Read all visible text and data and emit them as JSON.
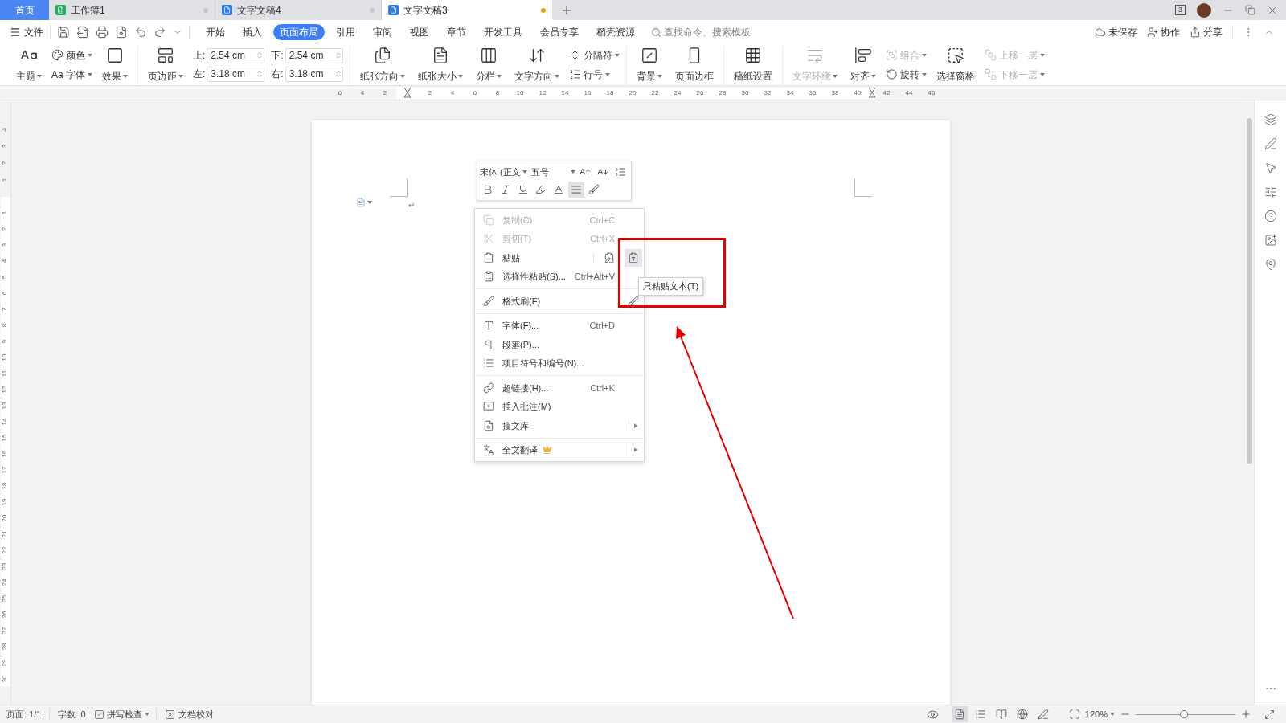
{
  "window": {
    "window_count": "3"
  },
  "tabs": [
    {
      "label": "首页",
      "kind": "home",
      "selected": false
    },
    {
      "label": "工作簿1",
      "kind": "sheet",
      "selected": false,
      "unsaved": false
    },
    {
      "label": "文字文稿4",
      "kind": "writer",
      "selected": false,
      "unsaved": false
    },
    {
      "label": "文字文稿3",
      "kind": "writer",
      "selected": true,
      "unsaved": true
    }
  ],
  "menu": {
    "file": "文件",
    "tabs": [
      {
        "label": "开始",
        "selected": false
      },
      {
        "label": "插入",
        "selected": false
      },
      {
        "label": "页面布局",
        "selected": true
      },
      {
        "label": "引用",
        "selected": false
      },
      {
        "label": "审阅",
        "selected": false
      },
      {
        "label": "视图",
        "selected": false
      },
      {
        "label": "章节",
        "selected": false
      },
      {
        "label": "开发工具",
        "selected": false
      },
      {
        "label": "会员专享",
        "selected": false
      },
      {
        "label": "稻壳资源",
        "selected": false
      }
    ],
    "search": {
      "placeholder": "查找命令、搜索模板"
    },
    "actions": [
      "未保存",
      "协作",
      "分享"
    ]
  },
  "ribbon": {
    "groups": [
      {
        "items": [
          {
            "kind": "large",
            "label": "主题",
            "dropdown": true,
            "disabled": false
          },
          {
            "kind": "stack",
            "entries": [
              {
                "label": "颜色",
                "dropdown": true,
                "disabled": false
              },
              {
                "glyph": "Aa",
                "label": "字体",
                "dropdown": true,
                "disabled": false
              }
            ]
          },
          {
            "kind": "large",
            "label": "效果",
            "dropdown": true,
            "disabled": false
          }
        ]
      },
      {
        "items": [
          {
            "kind": "large",
            "label": "页边距",
            "dropdown": true,
            "disabled": false
          },
          {
            "kind": "margins",
            "fields": [
              {
                "label": "上:",
                "value": "2.54 cm"
              },
              {
                "label": "下:",
                "value": "2.54 cm"
              },
              {
                "label": "左:",
                "value": "3.18 cm"
              },
              {
                "label": "右:",
                "value": "3.18 cm"
              }
            ]
          }
        ]
      },
      {
        "items": [
          {
            "kind": "large",
            "label": "纸张方向",
            "dropdown": true,
            "disabled": false
          },
          {
            "kind": "large",
            "label": "纸张大小",
            "dropdown": true,
            "disabled": false
          },
          {
            "kind": "large",
            "label": "分栏",
            "dropdown": true,
            "disabled": false
          },
          {
            "kind": "large",
            "label": "文字方向",
            "dropdown": true,
            "disabled": false
          },
          {
            "kind": "stack",
            "entries": [
              {
                "label": "分隔符",
                "dropdown": true,
                "disabled": false
              },
              {
                "label": "行号",
                "dropdown": true,
                "disabled": false
              }
            ]
          }
        ]
      },
      {
        "items": [
          {
            "kind": "large",
            "label": "背景",
            "dropdown": true,
            "disabled": false
          },
          {
            "kind": "large",
            "label": "页面边框",
            "dropdown": false,
            "disabled": false
          }
        ]
      },
      {
        "items": [
          {
            "kind": "large",
            "label": "稿纸设置",
            "dropdown": false,
            "disabled": false
          }
        ]
      },
      {
        "items": [
          {
            "kind": "large",
            "label": "文字环绕",
            "dropdown": true,
            "disabled": true
          },
          {
            "kind": "large",
            "label": "对齐",
            "dropdown": true,
            "disabled": false
          },
          {
            "kind": "stack",
            "entries": [
              {
                "label": "组合",
                "dropdown": true,
                "disabled": true
              },
              {
                "label": "旋转",
                "dropdown": true,
                "disabled": false
              }
            ]
          },
          {
            "kind": "large",
            "label": "选择窗格",
            "dropdown": false,
            "disabled": false
          },
          {
            "kind": "stack",
            "entries": [
              {
                "label": "上移一层",
                "dropdown": true,
                "disabled": true
              },
              {
                "label": "下移一层",
                "dropdown": true,
                "disabled": true
              }
            ]
          }
        ]
      }
    ]
  },
  "ruler": {
    "before": [
      "6",
      "4",
      "2"
    ],
    "inside": [
      "2",
      "4",
      "6",
      "8",
      "10",
      "12",
      "14",
      "16",
      "18",
      "20",
      "22",
      "24",
      "26",
      "28",
      "30",
      "32",
      "34",
      "36",
      "38",
      "40"
    ],
    "after": [
      "42",
      "44",
      "46"
    ],
    "above": [
      "4",
      "3",
      "2",
      "1"
    ],
    "below": [
      "1",
      "2",
      "3",
      "4",
      "5",
      "6",
      "7",
      "8",
      "9",
      "10",
      "11",
      "12",
      "13",
      "14",
      "15",
      "16",
      "17",
      "18",
      "19",
      "20",
      "21",
      "22",
      "23",
      "24",
      "25",
      "26",
      "27",
      "28",
      "29",
      "30"
    ]
  },
  "page": {
    "paragraph_mark": "↵"
  },
  "mini_toolbar": {
    "font": "宋体 (正文",
    "size": "五号",
    "buttons": [
      {
        "kind": "grow",
        "selected": false
      },
      {
        "kind": "shrink",
        "selected": false
      },
      {
        "kind": "spacing",
        "selected": false
      },
      {
        "kind": "bold",
        "selected": false
      },
      {
        "kind": "italic",
        "selected": false
      },
      {
        "kind": "underline",
        "selected": false
      },
      {
        "kind": "highlight",
        "selected": false
      },
      {
        "kind": "color",
        "selected": false
      },
      {
        "kind": "align",
        "selected": true
      },
      {
        "kind": "painter",
        "selected": false
      }
    ]
  },
  "context_menu": {
    "sections": [
      [
        {
          "kind": "item",
          "label": "复制(C)",
          "shortcut": "Ctrl+C",
          "disabled": true,
          "submenu": false
        },
        {
          "kind": "item",
          "label": "剪切(T)",
          "shortcut": "Ctrl+X",
          "disabled": true,
          "submenu": false
        },
        {
          "kind": "paste",
          "label": "粘贴",
          "disabled": false,
          "submenu": false,
          "options": [
            {
              "selected": false
            },
            {
              "selected": true
            }
          ]
        },
        {
          "kind": "item",
          "label": "选择性粘贴(S)...",
          "shortcut": "Ctrl+Alt+V",
          "disabled": false,
          "submenu": false
        }
      ],
      [
        {
          "kind": "format",
          "label": "格式刷(F)",
          "disabled": false,
          "submenu": false
        }
      ],
      [
        {
          "kind": "item",
          "label": "字体(F)...",
          "shortcut": "Ctrl+D",
          "disabled": false,
          "submenu": false
        },
        {
          "kind": "item",
          "label": "段落(P)...",
          "disabled": false,
          "submenu": false
        },
        {
          "kind": "item",
          "label": "项目符号和编号(N)...",
          "disabled": false,
          "submenu": false
        }
      ],
      [
        {
          "kind": "item",
          "label": "超链接(H)...",
          "shortcut": "Ctrl+K",
          "disabled": false,
          "submenu": false
        },
        {
          "kind": "item",
          "label": "插入批注(M)",
          "disabled": false,
          "submenu": false
        },
        {
          "kind": "item",
          "label": "搜文库",
          "disabled": false,
          "submenu": true
        }
      ],
      [
        {
          "kind": "premium",
          "label": "全文翻译",
          "disabled": false,
          "submenu": true
        }
      ]
    ]
  },
  "tooltip": "只粘贴文本(T)",
  "status_bar": {
    "page": "页面: 1/1",
    "words": "字数: 0",
    "spell_check": {
      "label": "拼写检查",
      "checked": true
    },
    "proofread": "文档校对",
    "views": [
      {
        "kind": "page",
        "selected": true
      },
      {
        "kind": "outline",
        "selected": false
      },
      {
        "kind": "read",
        "selected": false
      },
      {
        "kind": "web",
        "selected": false
      },
      {
        "kind": "write",
        "selected": false
      }
    ],
    "zoom": {
      "label": "120%",
      "level": 0.48
    }
  },
  "annotations": {
    "highlight_box": true,
    "arrow": true
  }
}
